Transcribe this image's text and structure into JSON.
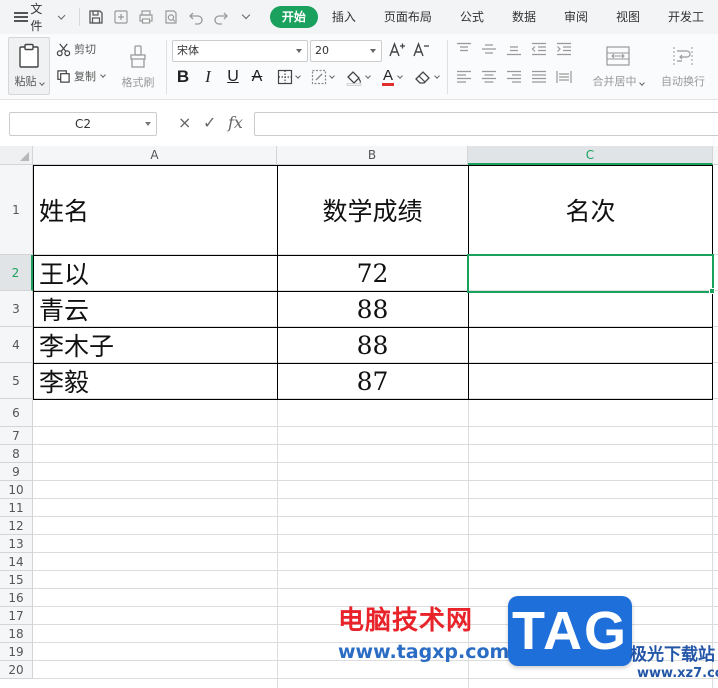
{
  "menubar": {
    "file_label": "文件",
    "tabs": [
      {
        "label": "开始",
        "active": true
      },
      {
        "label": "插入",
        "active": false
      },
      {
        "label": "页面布局",
        "active": false
      },
      {
        "label": "公式",
        "active": false
      },
      {
        "label": "数据",
        "active": false
      },
      {
        "label": "审阅",
        "active": false
      },
      {
        "label": "视图",
        "active": false
      },
      {
        "label": "开发工",
        "active": false
      }
    ],
    "quick_access_icons": [
      "save-icon",
      "export-icon",
      "print-icon",
      "print-preview-icon",
      "undo-icon",
      "redo-icon",
      "more-icon"
    ]
  },
  "ribbon": {
    "paste_label": "粘贴",
    "cut_label": "剪切",
    "copy_label": "复制",
    "format_painter_label": "格式刷",
    "font_name": "宋体",
    "font_size": "20",
    "merge_center_label": "合并居中",
    "wrap_text_label": "自动换行",
    "font_color": "#e03030",
    "accent_color": "#1aa15d"
  },
  "formula_bar": {
    "name_box": "C2",
    "cancel_symbol": "×",
    "confirm_symbol": "✓",
    "fx_symbol": "fx",
    "content": ""
  },
  "sheet": {
    "columns": [
      "A",
      "B",
      "C"
    ],
    "rows": [
      "1",
      "2",
      "3",
      "4",
      "5",
      "6",
      "7",
      "8",
      "9",
      "10",
      "11",
      "12",
      "13",
      "14",
      "15",
      "16",
      "17",
      "18",
      "19",
      "20"
    ],
    "selected_cell": "C2",
    "headers": {
      "a": "姓名",
      "b": "数学成绩",
      "c": "名次"
    },
    "data": [
      {
        "name": "王以",
        "score": "72",
        "rank": ""
      },
      {
        "name": "青云",
        "score": "88",
        "rank": ""
      },
      {
        "name": "李木子",
        "score": "88",
        "rank": ""
      },
      {
        "name": "李毅",
        "score": "87",
        "rank": ""
      }
    ]
  },
  "watermark": {
    "cn_text": "电脑技术网",
    "url": "www.tagxp.com",
    "logo": "TAG",
    "site_cn": "极光下载站",
    "site": "www.xz7.com"
  }
}
